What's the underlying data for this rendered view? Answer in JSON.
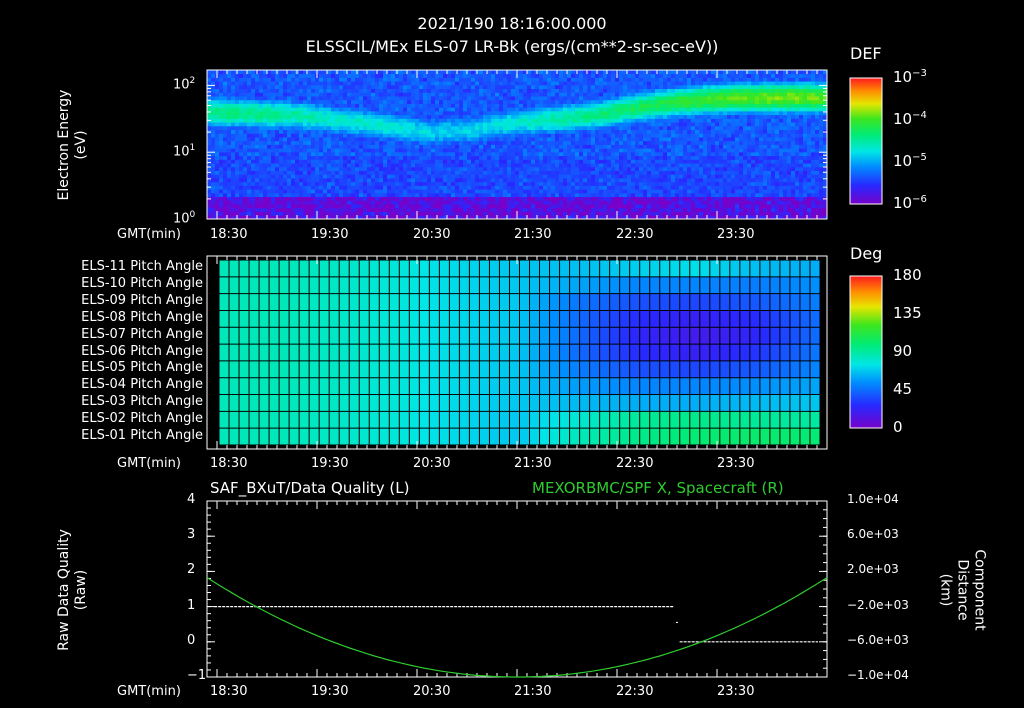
{
  "header": {
    "timestamp": "2021/190 18:16:00.000"
  },
  "chart_data": [
    {
      "type": "heatmap",
      "title": "ELSSCIL/MEx ELS-07 LR-Bk  (ergs/(cm**2-sr-sec-eV))",
      "ylabel": "Electron Energy\n(eV)",
      "xlabel": "GMT(min)",
      "x_ticks": [
        "18:30",
        "19:30",
        "20:30",
        "21:30",
        "22:30",
        "23:30"
      ],
      "y_scale": "log",
      "y_ticks": [
        "10^0",
        "10^1",
        "10^2"
      ],
      "ylim": [
        1,
        170
      ],
      "colorbar": {
        "label": "DEF",
        "ticks": [
          "10^-3",
          "10^-4",
          "10^-5",
          "10^-6"
        ],
        "scale": "log",
        "range": [
          1e-06,
          0.001
        ]
      },
      "band_center_eV": [
        40,
        38,
        36,
        30,
        25,
        20,
        22,
        28,
        32,
        38,
        50,
        60,
        65,
        66,
        66
      ],
      "band_level": [
        0.55,
        0.55,
        0.5,
        0.45,
        0.45,
        0.4,
        0.4,
        0.45,
        0.5,
        0.55,
        0.6,
        0.65,
        0.7,
        0.72,
        0.7
      ]
    },
    {
      "type": "heatmap",
      "ylabel": "",
      "xlabel": "GMT(min)",
      "x_ticks": [
        "18:30",
        "19:30",
        "20:30",
        "21:30",
        "22:30",
        "23:30"
      ],
      "rows": [
        "ELS-11 Pitch Angle",
        "ELS-10 Pitch Angle",
        "ELS-09 Pitch Angle",
        "ELS-08 Pitch Angle",
        "ELS-07 Pitch Angle",
        "ELS-06 Pitch Angle",
        "ELS-05 Pitch Angle",
        "ELS-04 Pitch Angle",
        "ELS-03 Pitch Angle",
        "ELS-02 Pitch Angle",
        "ELS-01 Pitch Angle"
      ],
      "colorbar": {
        "label": "Deg",
        "ticks": [
          "180",
          "135",
          "90",
          "45",
          "0"
        ],
        "range": [
          0,
          180
        ]
      },
      "values_deg": [
        [
          85,
          85,
          82,
          78,
          72,
          68,
          66,
          70,
          74,
          66,
          62
        ],
        [
          85,
          85,
          82,
          78,
          72,
          68,
          60,
          52,
          52,
          50,
          55
        ],
        [
          85,
          85,
          82,
          78,
          72,
          68,
          48,
          38,
          35,
          40,
          50
        ],
        [
          85,
          85,
          82,
          78,
          72,
          68,
          45,
          28,
          22,
          28,
          45
        ],
        [
          85,
          85,
          82,
          78,
          72,
          68,
          45,
          25,
          18,
          25,
          45
        ],
        [
          85,
          85,
          82,
          78,
          72,
          68,
          45,
          28,
          22,
          30,
          48
        ],
        [
          85,
          85,
          82,
          78,
          72,
          68,
          50,
          38,
          35,
          40,
          52
        ],
        [
          85,
          85,
          82,
          78,
          72,
          68,
          58,
          52,
          52,
          55,
          60
        ],
        [
          85,
          85,
          82,
          78,
          72,
          68,
          65,
          62,
          62,
          65,
          68
        ],
        [
          85,
          85,
          82,
          78,
          72,
          68,
          80,
          92,
          95,
          92,
          90
        ],
        [
          85,
          85,
          82,
          78,
          72,
          68,
          85,
          95,
          100,
          102,
          100
        ]
      ]
    },
    {
      "type": "line",
      "title_left": "SAF_BXuT/Data Quality (L)",
      "title_right": "MEXORBMC/SPF X, Spacecraft (R)",
      "ylabel_left": "Raw Data Quality\n(Raw)",
      "ylabel_right": "Component Distance\n(km)",
      "xlabel": "GMT(min)",
      "x_ticks": [
        "18:30",
        "19:30",
        "20:30",
        "21:30",
        "22:30",
        "23:30"
      ],
      "ylim_left": [
        -1,
        4
      ],
      "y_ticks_left": [
        "4",
        "3",
        "2",
        "1",
        "0",
        "−1"
      ],
      "ylim_right": [
        -10000,
        10000
      ],
      "y_ticks_right": [
        "1.0e+04",
        "6.0e+03",
        "2.0e+03",
        "−2.0e+03",
        "−6.0e+03",
        "−1.0e+04"
      ],
      "xlim_min": [
        0,
        345
      ],
      "series": [
        {
          "name": "SAF_BXuT/Data Quality",
          "axis": "left",
          "color": "#ffffff",
          "segments": [
            {
              "x": [
                4,
                260
              ],
              "y": [
                1,
                1
              ]
            },
            {
              "x": [
                261,
                262
              ],
              "y": [
                0.55,
                0.55
              ]
            },
            {
              "x": [
                263,
                340
              ],
              "y": [
                0,
                0
              ]
            }
          ]
        },
        {
          "name": "MEXORBMC/SPF X, Spacecraft",
          "axis": "right",
          "color": "#2ecc2e",
          "x": [
            0,
            20,
            40,
            60,
            80,
            100,
            120,
            140,
            160,
            180,
            200,
            220,
            240,
            260,
            280,
            300,
            320,
            345
          ],
          "y": [
            1300,
            -1500,
            -3900,
            -5900,
            -7500,
            -8700,
            -9500,
            -9900,
            -10000,
            -9900,
            -9500,
            -8700,
            -7500,
            -5900,
            -3900,
            -1500,
            1300,
            1300
          ]
        }
      ]
    }
  ],
  "colors": {
    "green_series": "#2ecc2e",
    "background": "#000000",
    "axis": "#ffffff"
  }
}
